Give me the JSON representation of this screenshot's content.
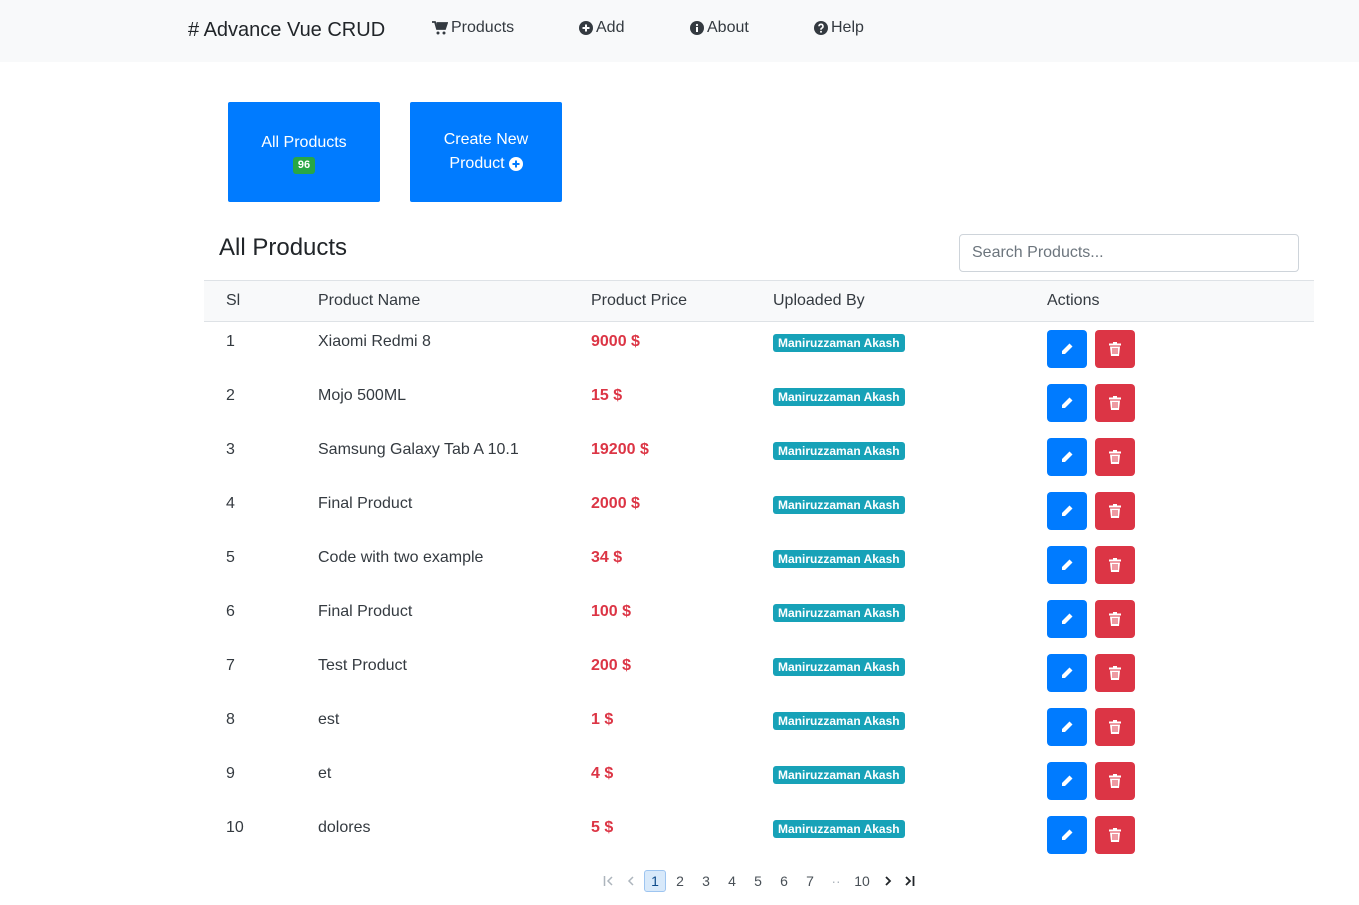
{
  "navbar": {
    "brand": "# Advance Vue CRUD",
    "items": [
      {
        "label": "Products",
        "icon": "cart-icon"
      },
      {
        "label": "Add",
        "icon": "plus-circle-icon"
      },
      {
        "label": "About",
        "icon": "info-circle-icon"
      },
      {
        "label": "Help",
        "icon": "question-circle-icon"
      }
    ]
  },
  "cards": {
    "all_products": {
      "label": "All Products",
      "count": "96"
    },
    "create_new": {
      "line1": "Create New",
      "line2": "Product"
    }
  },
  "page_title": "All Products",
  "search": {
    "placeholder": "Search Products...",
    "value": ""
  },
  "table": {
    "headers": [
      "Sl",
      "Product Name",
      "Product Price",
      "Uploaded By",
      "Actions"
    ],
    "rows": [
      {
        "sl": "1",
        "name": "Xiaomi Redmi 8",
        "price": "9000 $",
        "uploader": "Maniruzzaman Akash"
      },
      {
        "sl": "2",
        "name": "Mojo 500ML",
        "price": "15 $",
        "uploader": "Maniruzzaman Akash"
      },
      {
        "sl": "3",
        "name": "Samsung Galaxy Tab A 10.1",
        "price": "19200 $",
        "uploader": "Maniruzzaman Akash"
      },
      {
        "sl": "4",
        "name": "Final Product",
        "price": "2000 $",
        "uploader": "Maniruzzaman Akash"
      },
      {
        "sl": "5",
        "name": "Code with two example",
        "price": "34 $",
        "uploader": "Maniruzzaman Akash"
      },
      {
        "sl": "6",
        "name": "Final Product",
        "price": "100 $",
        "uploader": "Maniruzzaman Akash"
      },
      {
        "sl": "7",
        "name": "Test Product",
        "price": "200 $",
        "uploader": "Maniruzzaman Akash"
      },
      {
        "sl": "8",
        "name": "est",
        "price": "1 $",
        "uploader": "Maniruzzaman Akash"
      },
      {
        "sl": "9",
        "name": "et",
        "price": "4 $",
        "uploader": "Maniruzzaman Akash"
      },
      {
        "sl": "10",
        "name": "dolores",
        "price": "5 $",
        "uploader": "Maniruzzaman Akash"
      }
    ]
  },
  "pagination": {
    "pages": [
      "1",
      "2",
      "3",
      "4",
      "5",
      "6",
      "7"
    ],
    "ellipsis": "··",
    "last": "10",
    "current": "1",
    "icons": [
      "first-page-icon",
      "prev-page-icon",
      "next-page-icon",
      "last-page-icon"
    ]
  },
  "colors": {
    "primary": "#007bff",
    "danger": "#dc3545",
    "success": "#28a745",
    "info": "#17a2b8"
  }
}
